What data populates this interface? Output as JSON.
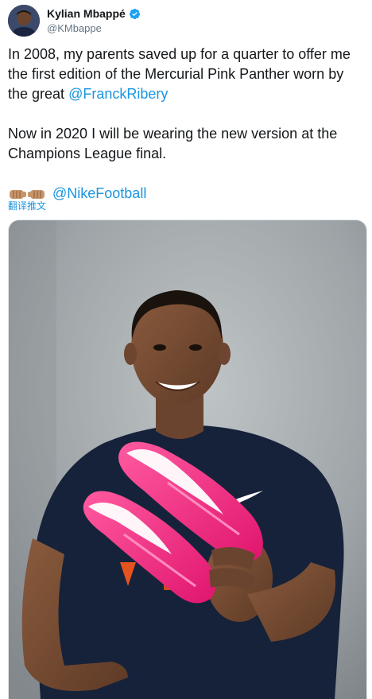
{
  "author": {
    "display_name": "Kylian Mbappé",
    "handle": "@KMbappe",
    "verified": true,
    "avatar_icon": "profile-photo"
  },
  "tweet": {
    "line1_pre": "In 2008, my parents saved up for a quarter to offer me the first edition of the Mercurial Pink Panther worn by the great ",
    "mention1": "@FranckRibery",
    "para2": "Now in 2020 I will be wearing the new version at the Champions League final.",
    "fist_emoji": "🤜🏽🤛🏽",
    "mention2": "@NikeFootball"
  },
  "translate_label": "翻译推文",
  "colors": {
    "link": "#1b95e0",
    "verified": "#1da1f2",
    "boot_pink": "#ff2e88",
    "shirt_navy": "#16223a"
  },
  "media": {
    "type": "photo",
    "description_icon": "player-holding-pink-boots-photo"
  }
}
